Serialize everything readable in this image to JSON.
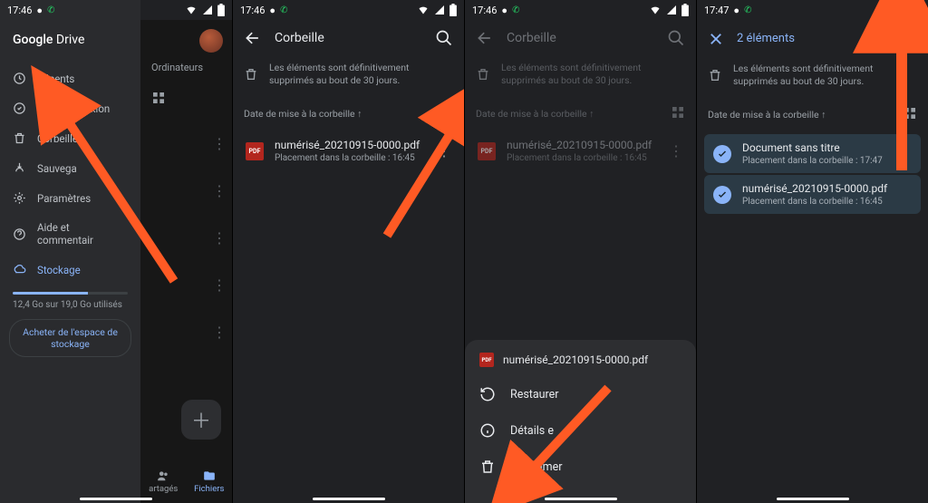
{
  "status": {
    "time": "17:46",
    "time4": "17:47"
  },
  "drawer": {
    "brand_google": "Google",
    "brand_drive": "Drive",
    "items": [
      {
        "icon": "clock",
        "label": "Récents"
      },
      {
        "icon": "offline",
        "label": "Hors connexion"
      },
      {
        "icon": "trash",
        "label": "Corbeille"
      },
      {
        "icon": "backup",
        "label": "Sauvega"
      },
      {
        "icon": "gear",
        "label": "Paramètres"
      },
      {
        "icon": "help",
        "label": "Aide et commentair"
      },
      {
        "icon": "cloud",
        "label": "Stockage"
      }
    ],
    "storage_text": "12,4 Go sur 19,0 Go utilisés",
    "buy": "Acheter de l'espace de stockage"
  },
  "pane1": {
    "computers": "Ordinateurs",
    "tab_shared": "artagés",
    "tab_files": "Fichiers"
  },
  "trash": {
    "title": "Corbeille",
    "notice": "Les éléments sont définitivement supprimés au bout de 30 jours.",
    "sort_label": "Date de mise à la corbeille ↑",
    "file_name": "numérisé_20210915-0000.pdf",
    "file_sub": "Placement dans la corbeille : 16:45"
  },
  "sheet": {
    "file_name": "numérisé_20210915-0000.pdf",
    "restore": "Restaurer",
    "details": "Détails e",
    "delete": "Supprimer"
  },
  "selection": {
    "count_label": "2 éléments",
    "notice": "Les éléments sont définitivement supprimés au bout de 30 jours.",
    "sort_label": "Date de mise à la corbeille ↑",
    "doc_name": "Document sans titre",
    "doc_sub": "Placement dans la corbeille : 17:47",
    "pdf_name": "numérisé_20210915-0000.pdf",
    "pdf_sub": "Placement dans la corbeille : 16:45"
  }
}
